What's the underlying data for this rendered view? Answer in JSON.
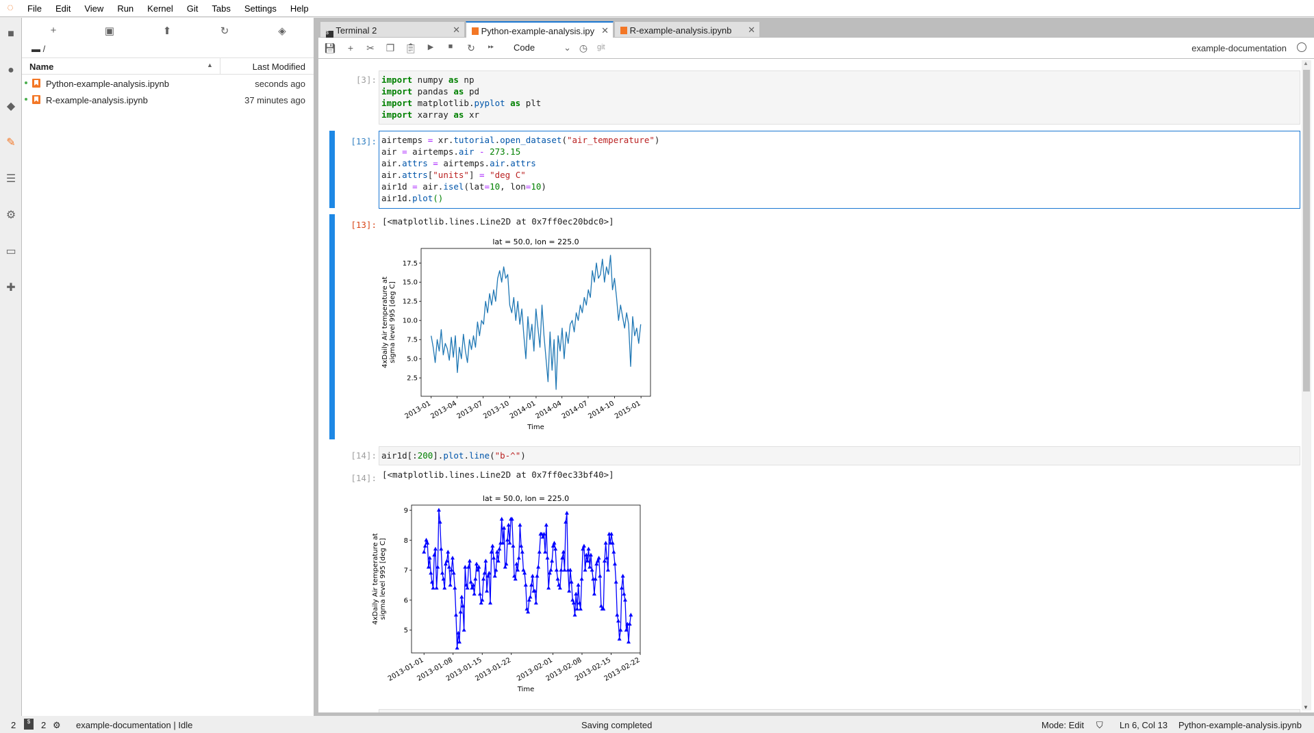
{
  "menu": [
    "File",
    "Edit",
    "View",
    "Run",
    "Kernel",
    "Git",
    "Tabs",
    "Settings",
    "Help"
  ],
  "filebrowser": {
    "path": "/",
    "columns": {
      "name": "Name",
      "modified": "Last Modified"
    },
    "files": [
      {
        "name": "Python-example-analysis.ipynb",
        "modified": "seconds ago"
      },
      {
        "name": "R-example-analysis.ipynb",
        "modified": "37 minutes ago"
      }
    ]
  },
  "tabs": [
    {
      "label": "Terminal 2",
      "icon": "terminal-icon"
    },
    {
      "label": "Python-example-analysis.ipy",
      "icon": "notebook-icon",
      "active": true
    },
    {
      "label": "R-example-analysis.ipynb",
      "icon": "notebook-icon"
    }
  ],
  "toolbar": {
    "cell_type": "Code",
    "git": "git",
    "kernel_name": "example-documentation"
  },
  "cells": {
    "c3": {
      "prompt": "[3]:"
    },
    "c13": {
      "prompt": "[13]:",
      "out_prompt": "[13]:",
      "out_text": "[<matplotlib.lines.Line2D at 0x7ff0ec20bdc0>]"
    },
    "c14": {
      "prompt": "[14]:",
      "out_prompt": "[14]:",
      "out_text": "[<matplotlib.lines.Line2D at 0x7ff0ec33bf40>]"
    }
  },
  "code_tokens": {
    "c3": [
      [
        "import",
        "kw"
      ],
      [
        " numpy ",
        ""
      ],
      [
        "as",
        "kw"
      ],
      [
        " np\n",
        ""
      ],
      [
        "import",
        "kw"
      ],
      [
        " pandas ",
        ""
      ],
      [
        "as",
        "kw"
      ],
      [
        " pd\n",
        ""
      ],
      [
        "import",
        "kw"
      ],
      [
        " matplotlib.",
        ""
      ],
      [
        "pyplot",
        "at"
      ],
      [
        " ",
        ""
      ],
      [
        "as",
        "kw"
      ],
      [
        " plt\n",
        ""
      ],
      [
        "import",
        "kw"
      ],
      [
        " xarray ",
        ""
      ],
      [
        "as",
        "kw"
      ],
      [
        " xr",
        ""
      ]
    ],
    "c13": [
      [
        "airtemps ",
        ""
      ],
      [
        "=",
        "op"
      ],
      [
        " xr.",
        ""
      ],
      [
        "tutorial",
        "at"
      ],
      [
        ".",
        ""
      ],
      [
        "open_dataset",
        "at"
      ],
      [
        "(",
        ""
      ],
      [
        "\"air_temperature\"",
        "st"
      ],
      [
        ")\nair ",
        ""
      ],
      [
        "=",
        "op"
      ],
      [
        " airtemps.",
        ""
      ],
      [
        "air",
        "at"
      ],
      [
        " ",
        ""
      ],
      [
        "-",
        "op"
      ],
      [
        " ",
        ""
      ],
      [
        "273.15",
        "nu"
      ],
      [
        "\nair.",
        ""
      ],
      [
        "attrs",
        "at"
      ],
      [
        " ",
        ""
      ],
      [
        "=",
        "op"
      ],
      [
        " airtemps.",
        ""
      ],
      [
        "air",
        "at"
      ],
      [
        ".",
        ""
      ],
      [
        "attrs",
        "at"
      ],
      [
        "\nair.",
        ""
      ],
      [
        "attrs",
        "at"
      ],
      [
        "[",
        ""
      ],
      [
        "\"units\"",
        "st"
      ],
      [
        "] ",
        ""
      ],
      [
        "=",
        "op"
      ],
      [
        " ",
        ""
      ],
      [
        "\"deg C\"",
        "st"
      ],
      [
        "\nair1d ",
        ""
      ],
      [
        "=",
        "op"
      ],
      [
        " air.",
        ""
      ],
      [
        "isel",
        "at"
      ],
      [
        "(lat",
        ""
      ],
      [
        "=",
        "op"
      ],
      [
        "10",
        "nu"
      ],
      [
        ", lon",
        ""
      ],
      [
        "=",
        "op"
      ],
      [
        "10",
        "nu"
      ],
      [
        ")\nair1d.",
        ""
      ],
      [
        "plot",
        "at"
      ],
      [
        "()",
        "nu"
      ]
    ],
    "c14": [
      [
        "air1d[:",
        ""
      ],
      [
        "200",
        "nu"
      ],
      [
        "].",
        ""
      ],
      [
        "plot",
        "at"
      ],
      [
        ".",
        ""
      ],
      [
        "line",
        "at"
      ],
      [
        "(",
        ""
      ],
      [
        "\"b-^\"",
        "st"
      ],
      [
        ")",
        ""
      ]
    ]
  },
  "chart_data": [
    {
      "type": "line",
      "title": "lat = 50.0, lon = 225.0",
      "xlabel": "Time",
      "ylabel": [
        "4xDaily Air temperature at",
        "sigma level 995 [deg C]"
      ],
      "xticks": [
        "2013-01",
        "2013-04",
        "2013-07",
        "2013-10",
        "2014-01",
        "2014-04",
        "2014-07",
        "2014-10",
        "2015-01"
      ],
      "yticks": [
        2.5,
        5.0,
        7.5,
        10.0,
        12.5,
        15.0,
        17.5
      ],
      "xlim": [
        "2012-11-27",
        "2015-02-03"
      ],
      "ylim": [
        0.1,
        19.4
      ],
      "x_range": [
        "2013-01-01",
        "2014-12-31"
      ],
      "color": "#1f77b4",
      "values": [
        8.0,
        6.5,
        4.5,
        7.5,
        6.0,
        8.8,
        5.5,
        7.0,
        6.3,
        4.8,
        7.8,
        5.2,
        8.0,
        3.2,
        6.5,
        5.0,
        8.2,
        6.0,
        4.5,
        7.5,
        6.2,
        8.0,
        6.5,
        9.8,
        8.0,
        10.0,
        9.5,
        12.5,
        11.0,
        13.5,
        12.0,
        14.0,
        12.5,
        15.5,
        16.5,
        15.0,
        17.0,
        15.5,
        16.0,
        12.0,
        11.0,
        13.0,
        10.0,
        12.5,
        9.5,
        11.5,
        8.0,
        5.0,
        10.5,
        7.5,
        9.5,
        6.0,
        11.5,
        9.0,
        6.5,
        12.0,
        8.0,
        5.0,
        2.0,
        8.5,
        3.5,
        7.5,
        1.0,
        8.0,
        6.0,
        9.0,
        5.0,
        8.5,
        7.0,
        9.5,
        10.0,
        8.5,
        11.0,
        10.0,
        12.0,
        11.0,
        13.0,
        12.0,
        14.0,
        13.0,
        16.5,
        15.0,
        17.5,
        15.5,
        16.0,
        18.0,
        15.0,
        17.0,
        16.0,
        18.5,
        14.0,
        15.5,
        13.0,
        10.0,
        12.0,
        10.5,
        9.0,
        11.0,
        9.5,
        4.0,
        10.5,
        8.0,
        9.0,
        7.0,
        9.5
      ]
    },
    {
      "type": "line",
      "title": "lat = 50.0, lon = 225.0",
      "xlabel": "Time",
      "ylabel": [
        "4xDaily Air temperature at",
        "sigma level 995 [deg C]"
      ],
      "xticks": [
        "2013-01-01",
        "2013-01-08",
        "2013-01-15",
        "2013-01-22",
        "2013-02-01",
        "2013-02-08",
        "2013-02-15",
        "2013-02-22"
      ],
      "yticks": [
        5,
        6,
        7,
        8,
        9
      ],
      "xlim": [
        "2012-12-29",
        "2013-02-22"
      ],
      "ylim": [
        4.24,
        9.17
      ],
      "x_range": [
        "2013-01-01",
        "2013-02-19"
      ],
      "color": "#0000ff",
      "marker": "triangle-up",
      "values": [
        7.6,
        7.8,
        8.0,
        7.9,
        7.1,
        7.4,
        6.9,
        6.6,
        6.4,
        7.5,
        7.7,
        6.4,
        7.1,
        9.0,
        8.6,
        7.7,
        6.9,
        6.7,
        6.4,
        7.2,
        7.3,
        7.6,
        7.1,
        6.5,
        7.0,
        7.4,
        6.9,
        6.4,
        5.5,
        4.4,
        4.9,
        4.6,
        5.6,
        6.1,
        5.8,
        5.0,
        7.1,
        6.5,
        6.4,
        7.1,
        7.3,
        6.6,
        6.4,
        6.5,
        6.2,
        6.7,
        7.2,
        7.0,
        7.1,
        6.2,
        5.9,
        6.0,
        6.7,
        6.9,
        7.3,
        6.3,
        6.8,
        6.9,
        5.9,
        7.6,
        7.8,
        7.4,
        6.8,
        7.0,
        7.6,
        7.3,
        7.7,
        7.9,
        8.7,
        7.9,
        8.4,
        7.1,
        7.2,
        8.0,
        8.5,
        7.9,
        8.7,
        8.7,
        7.8,
        6.8,
        6.7,
        7.2,
        7.0,
        7.4,
        8.5,
        7.8,
        7.6,
        7.0,
        6.9,
        6.5,
        5.7,
        5.6,
        6.0,
        6.1,
        6.5,
        6.8,
        6.3,
        6.3,
        5.9,
        6.8,
        7.1,
        7.6,
        8.2,
        8.2,
        8.1,
        8.2,
        7.6,
        8.5,
        7.4,
        6.4,
        6.9,
        7.0,
        7.3,
        7.8,
        7.9,
        7.7,
        7.0,
        6.7,
        6.5,
        6.4,
        7.0,
        7.4,
        7.6,
        7.0,
        8.6,
        8.9,
        7.0,
        6.3,
        7.0,
        6.6,
        6.0,
        5.9,
        5.5,
        6.2,
        5.7,
        6.5,
        5.9,
        5.7,
        6.7,
        7.7,
        7.8,
        7.0,
        7.5,
        7.3,
        7.7,
        7.1,
        7.5,
        7.0,
        6.7,
        6.2,
        6.7,
        7.2,
        7.3,
        7.4,
        6.8,
        5.8,
        5.7,
        5.7,
        7.3,
        7.9,
        7.4,
        7.0,
        8.2,
        7.9,
        8.2,
        7.9,
        7.6,
        7.2,
        6.6,
        5.5,
        5.3,
        4.7,
        5.0,
        6.4,
        6.8,
        6.2,
        6.0,
        5.0,
        5.2,
        4.6,
        5.2,
        5.5
      ]
    }
  ],
  "statusbar": {
    "terminals": "2",
    "kernels": "2",
    "kernel_status": "example-documentation | Idle",
    "message": "Saving completed",
    "mode": "Mode: Edit",
    "position": "Ln 6, Col 13",
    "file": "Python-example-analysis.ipynb"
  }
}
